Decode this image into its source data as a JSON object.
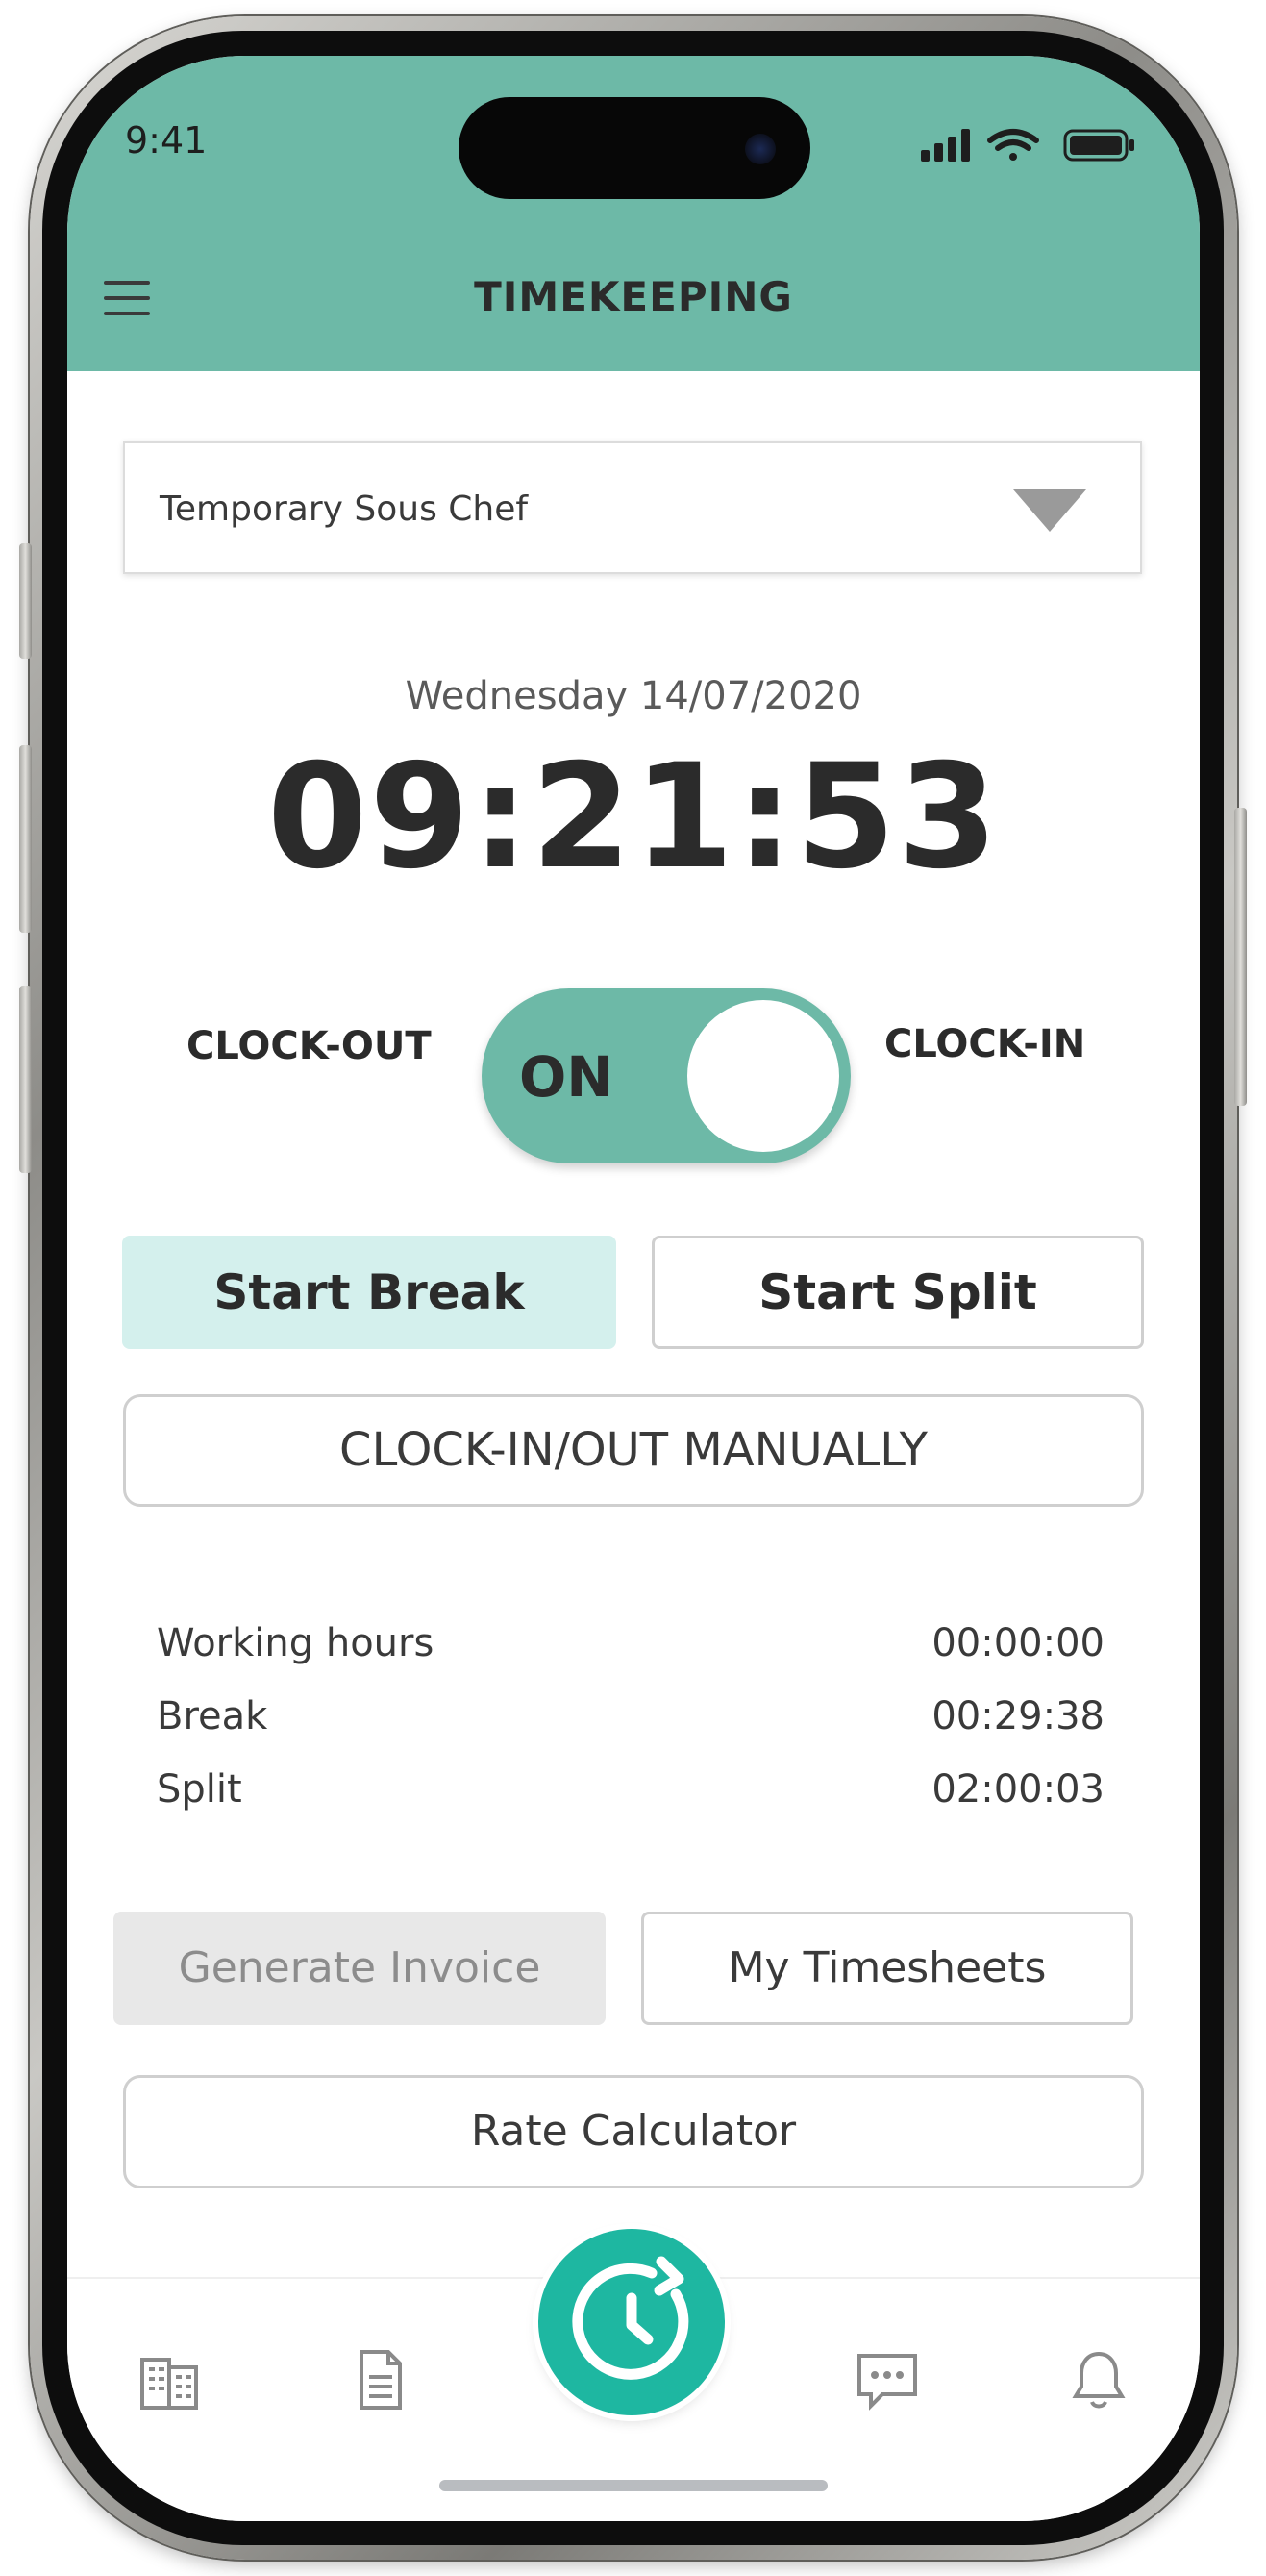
{
  "status_bar": {
    "time": "9:41"
  },
  "header": {
    "title": "TIMEKEEPING",
    "background": "#6db9a7"
  },
  "job_select": {
    "selected": "Temporary Sous Chef"
  },
  "clock": {
    "date": "Wednesday 14/07/2020",
    "time": "09:21:53"
  },
  "clock_toggle": {
    "left_label": "CLOCK-OUT",
    "right_label": "CLOCK-IN",
    "state_label": "ON",
    "color": "#6db9a7"
  },
  "actions": {
    "start_break": "Start Break",
    "start_split": "Start Split",
    "manual": "CLOCK-IN/OUT MANUALLY"
  },
  "stats": [
    {
      "label": "Working hours",
      "value": "00:00:00"
    },
    {
      "label": "Break",
      "value": "00:29:38"
    },
    {
      "label": "Split",
      "value": "02:00:03"
    }
  ],
  "bottom_actions": {
    "generate_invoice": "Generate Invoice",
    "my_timesheets": "My Timesheets",
    "rate_calculator": "Rate Calculator"
  },
  "tabbar": {
    "items": [
      {
        "icon": "building-icon"
      },
      {
        "icon": "document-icon"
      },
      {
        "icon": "clock-refresh-icon",
        "active": true
      },
      {
        "icon": "message-icon"
      },
      {
        "icon": "bell-icon"
      }
    ],
    "accent": "#1eb7a1"
  }
}
